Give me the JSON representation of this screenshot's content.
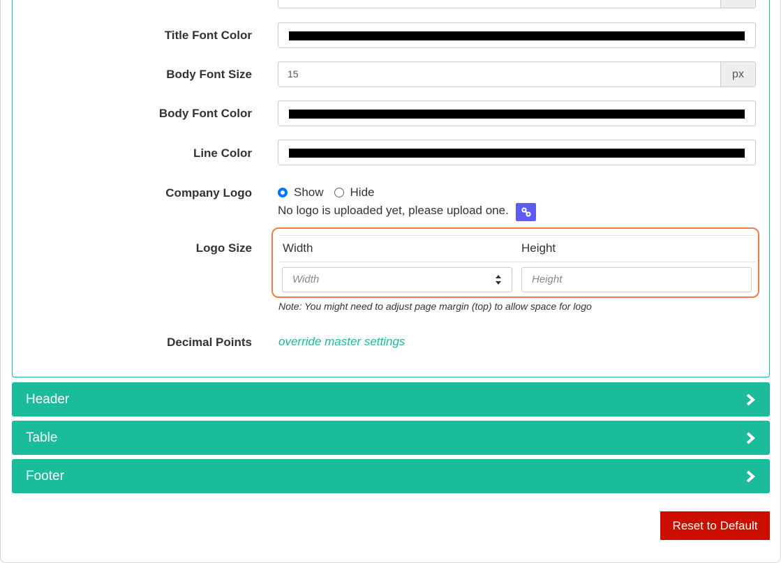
{
  "settings": {
    "title_font_color_label": "Title Font Color",
    "body_font_size_label": "Body Font Size",
    "body_font_size_value": "15",
    "body_font_size_unit": "px",
    "body_font_color_label": "Body Font Color",
    "line_color_label": "Line Color",
    "title_font_color": "#000000",
    "body_font_color": "#000000",
    "line_color": "#000000",
    "company_logo_label": "Company Logo",
    "logo_show_label": "Show",
    "logo_hide_label": "Hide",
    "logo_selected": "Show",
    "no_logo_text": "No logo is uploaded yet, please upload one.",
    "logo_size_label": "Logo Size",
    "width_header": "Width",
    "height_header": "Height",
    "width_placeholder": "Width",
    "height_placeholder": "Height",
    "logo_note": "Note: You might need to adjust page margin (top) to allow space for logo",
    "decimal_points_label": "Decimal Points",
    "override_link": "override master settings"
  },
  "sections": {
    "header": "Header",
    "table": "Table",
    "footer": "Footer"
  },
  "actions": {
    "reset_label": "Reset to Default"
  },
  "colors": {
    "accent": "#1abc9c",
    "danger": "#cc0e00",
    "link_button": "#5e5bf0",
    "highlight": "#f07c45"
  }
}
